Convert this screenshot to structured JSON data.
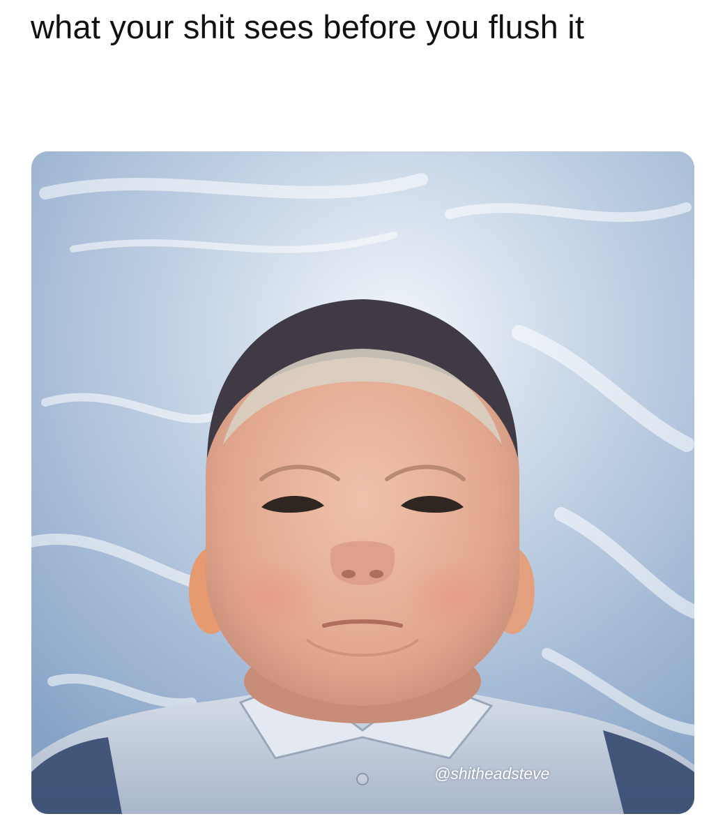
{
  "post": {
    "caption": "what your shit sees before you flush it",
    "watermark": "@shitheadsteve"
  },
  "photo": {
    "subject": "low-angle selfie of a person against a cloudy blue sky",
    "sky_color": "#9db6d3",
    "skin_color": "#e6b19b",
    "shirt_color": "#b9c4d6",
    "stripe_color": "#34496f"
  }
}
